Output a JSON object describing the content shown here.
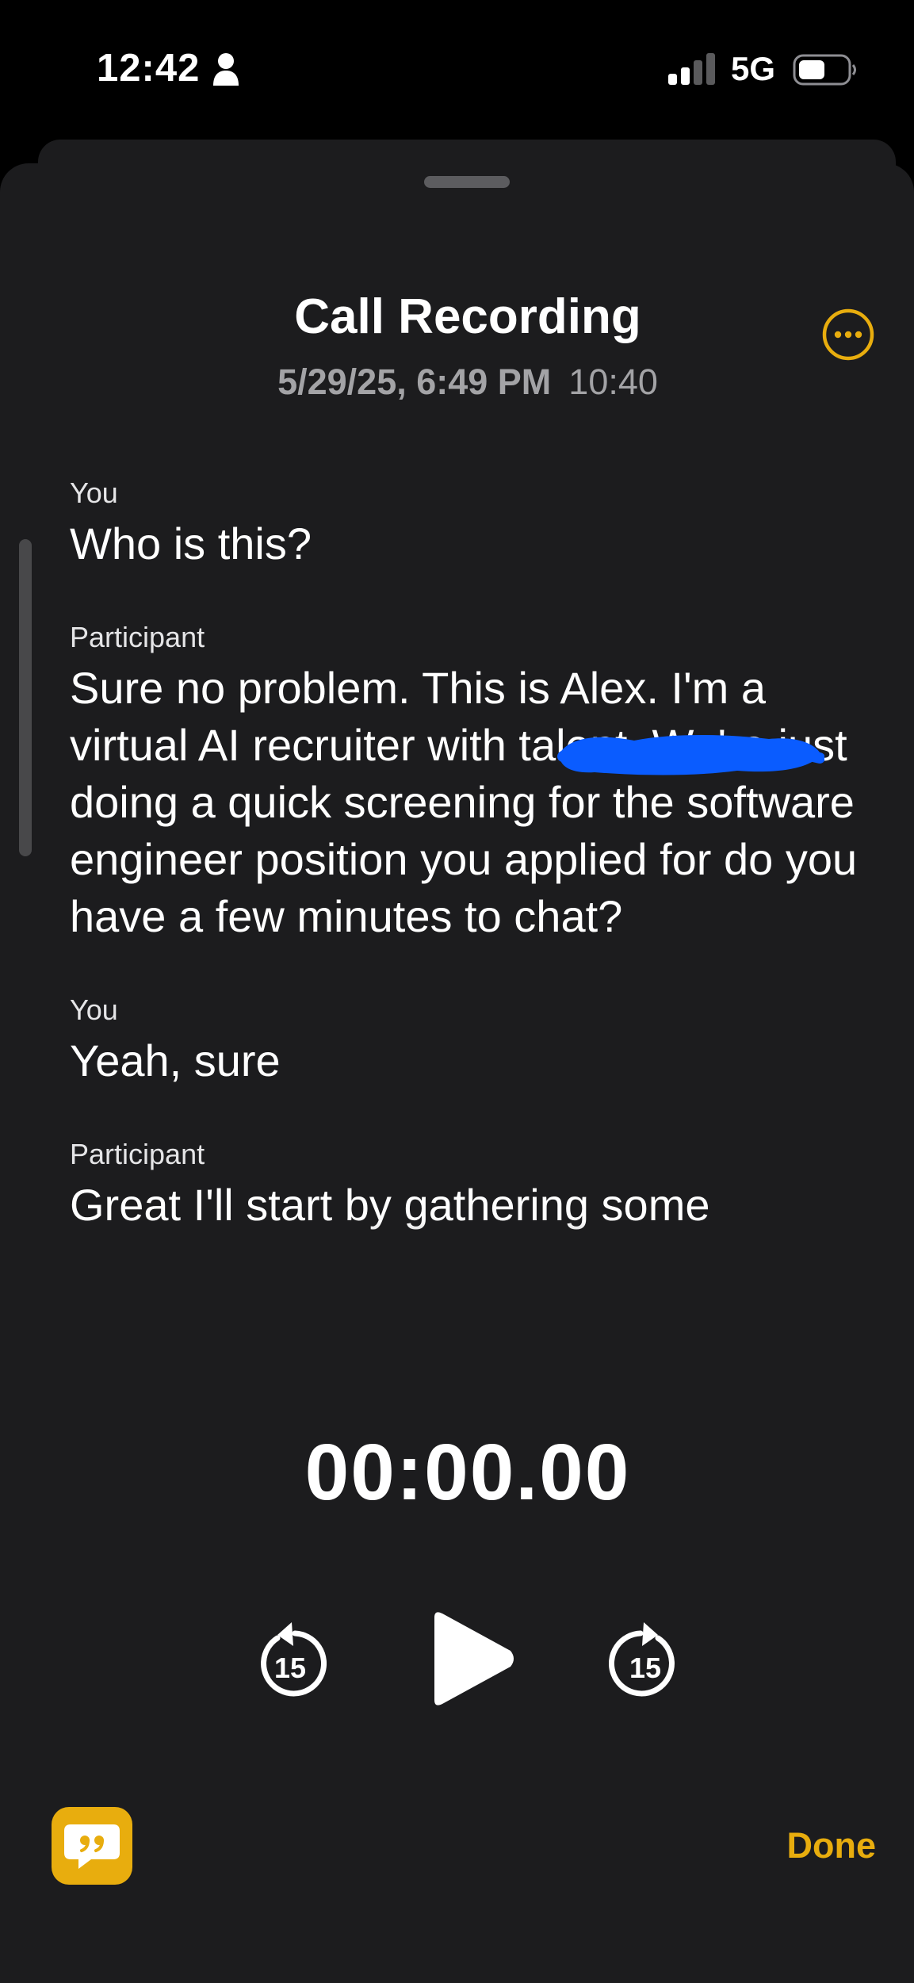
{
  "status_bar": {
    "time": "12:42",
    "network": "5G",
    "person_icon": "person-icon",
    "signal_icon": "signal-icon",
    "battery_icon": "battery-icon"
  },
  "header": {
    "title": "Call Recording",
    "date": "5/29/25, 6:49 PM",
    "duration": "10:40",
    "more_icon": "more-icon"
  },
  "transcript": [
    {
      "speaker": "You",
      "text": "Who is this?"
    },
    {
      "speaker": "Participant",
      "text": "Sure no problem. This is Alex. I'm a virtual AI recruiter with talent. We're just doing a quick screening for the software engineer position you applied for do you have a few minutes to chat?"
    },
    {
      "speaker": "You",
      "text": "Yeah, sure"
    },
    {
      "speaker": "Participant",
      "text": "Great I'll start by gathering some"
    }
  ],
  "player": {
    "time": "00:00.00",
    "skip_back_label": "15",
    "skip_forward_label": "15",
    "skip_back_icon": "skip-back-15-icon",
    "play_icon": "play-icon",
    "skip_forward_icon": "skip-forward-15-icon"
  },
  "footer": {
    "transcript_icon": "transcript-quote-icon",
    "done_label": "Done"
  },
  "colors": {
    "accent": "#e8ad0e",
    "sheet_background": "#1c1c1e",
    "redaction": "#0a5cff"
  }
}
